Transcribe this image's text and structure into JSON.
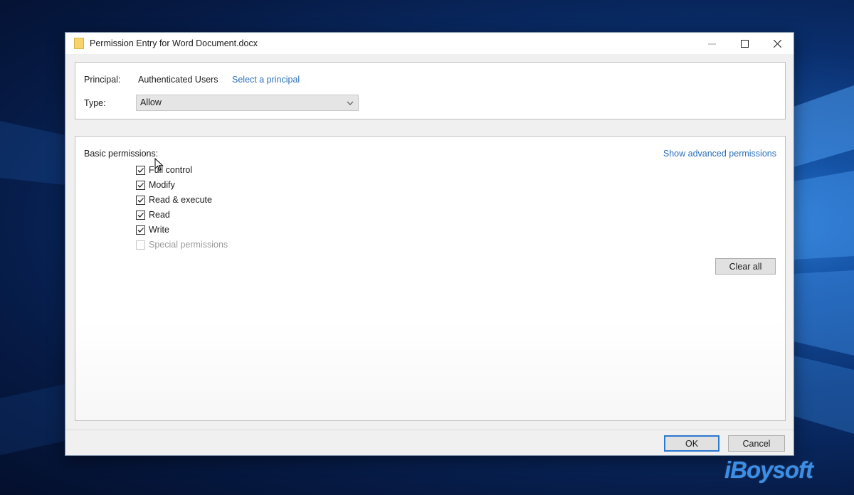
{
  "window": {
    "title": "Permission Entry for Word Document.docx"
  },
  "principal": {
    "label": "Principal:",
    "value": "Authenticated Users",
    "link": "Select a principal"
  },
  "type": {
    "label": "Type:",
    "selected": "Allow"
  },
  "permissions": {
    "heading": "Basic permissions:",
    "advanced_link": "Show advanced permissions",
    "items": [
      {
        "label": "Full control",
        "checked": true,
        "enabled": true
      },
      {
        "label": "Modify",
        "checked": true,
        "enabled": true
      },
      {
        "label": "Read & execute",
        "checked": true,
        "enabled": true
      },
      {
        "label": "Read",
        "checked": true,
        "enabled": true
      },
      {
        "label": "Write",
        "checked": true,
        "enabled": true
      },
      {
        "label": "Special permissions",
        "checked": false,
        "enabled": false
      }
    ],
    "clear_all": "Clear all"
  },
  "footer": {
    "ok": "OK",
    "cancel": "Cancel"
  },
  "watermark": "iBoysoft"
}
